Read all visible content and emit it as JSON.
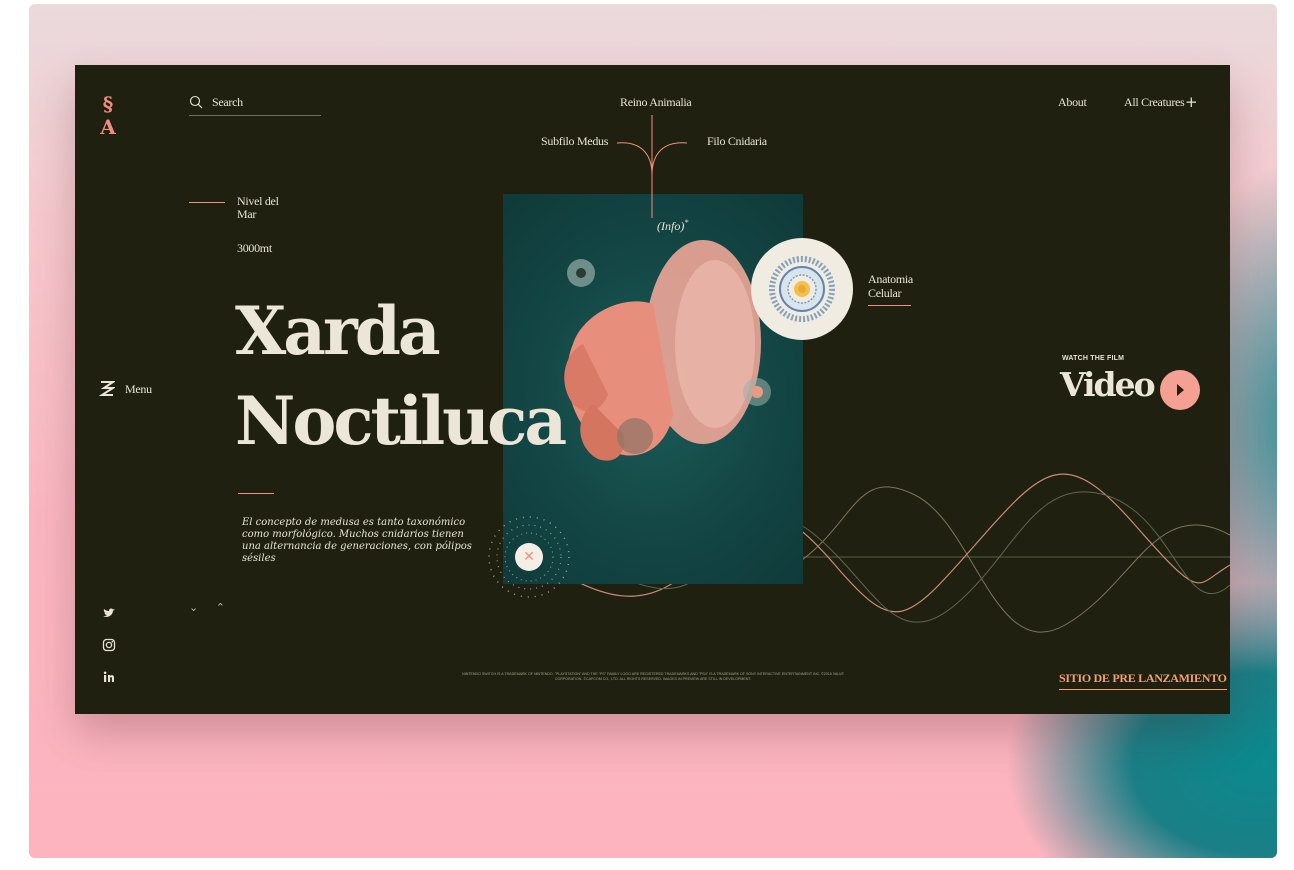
{
  "brand": {
    "logo_text": "S\nA",
    "logo_color": "#f08e80"
  },
  "header": {
    "search_label": "Search",
    "about_label": "About",
    "all_creatures_label": "All Creatures",
    "plus_symbol": "+"
  },
  "taxonomy": {
    "top": "Reino Animalia",
    "left": "Subfilo Medus",
    "right": "Filo Cnidaria",
    "info": "(Info)",
    "info_mark": "*"
  },
  "depth": {
    "label": "Nivel del Mar",
    "value": "3000mt"
  },
  "hero": {
    "title_line1": "Xarda",
    "title_line2": "Noctiluca",
    "description": "El concepto de medusa es tanto taxonómico como morfológico. Muchos cnidarios tienen una alternancia de generaciones, con pólipos sésiles"
  },
  "menu": {
    "label": "Menu"
  },
  "anatomy": {
    "label": "Anatomia Celular"
  },
  "video": {
    "eyebrow": "WATCH THE FILM",
    "label": "Video"
  },
  "footer": {
    "legal": "NINTENDO SWITCH IS A TRADEMARK OF NINTENDO. \"PLAYSTATION\" AND THE \"PS\" FAMILY LOGO ARE REGISTERED TRADEMARKS AND \"PS4\" IS A TRADEMARK OF SONY INTERACTIVE ENTERTAINMENT INC. ©2016 VALVE CORPORATION. ©CAPCOM CO., LTD. ALL RIGHTS RESERVED. IMAGES IN PREVIEW ARE STILL IN DEVELOPMENT.",
    "prelaunch": "SITIO DE PRE LANZAMIENTO"
  },
  "icons": {
    "search": "search-icon",
    "menu": "menu-icon",
    "twitter": "twitter-icon",
    "instagram": "instagram-icon",
    "linkedin": "linkedin-icon",
    "play": "play-icon",
    "close": "close-icon",
    "arrow_down": "chevron-down-icon",
    "arrow_up": "chevron-up-icon"
  },
  "colors": {
    "panel_bg": "#1f200f",
    "accent": "#f08e80",
    "cream": "#ece6d9",
    "teal": "#134644",
    "prelaunch": "#f0a07a"
  }
}
